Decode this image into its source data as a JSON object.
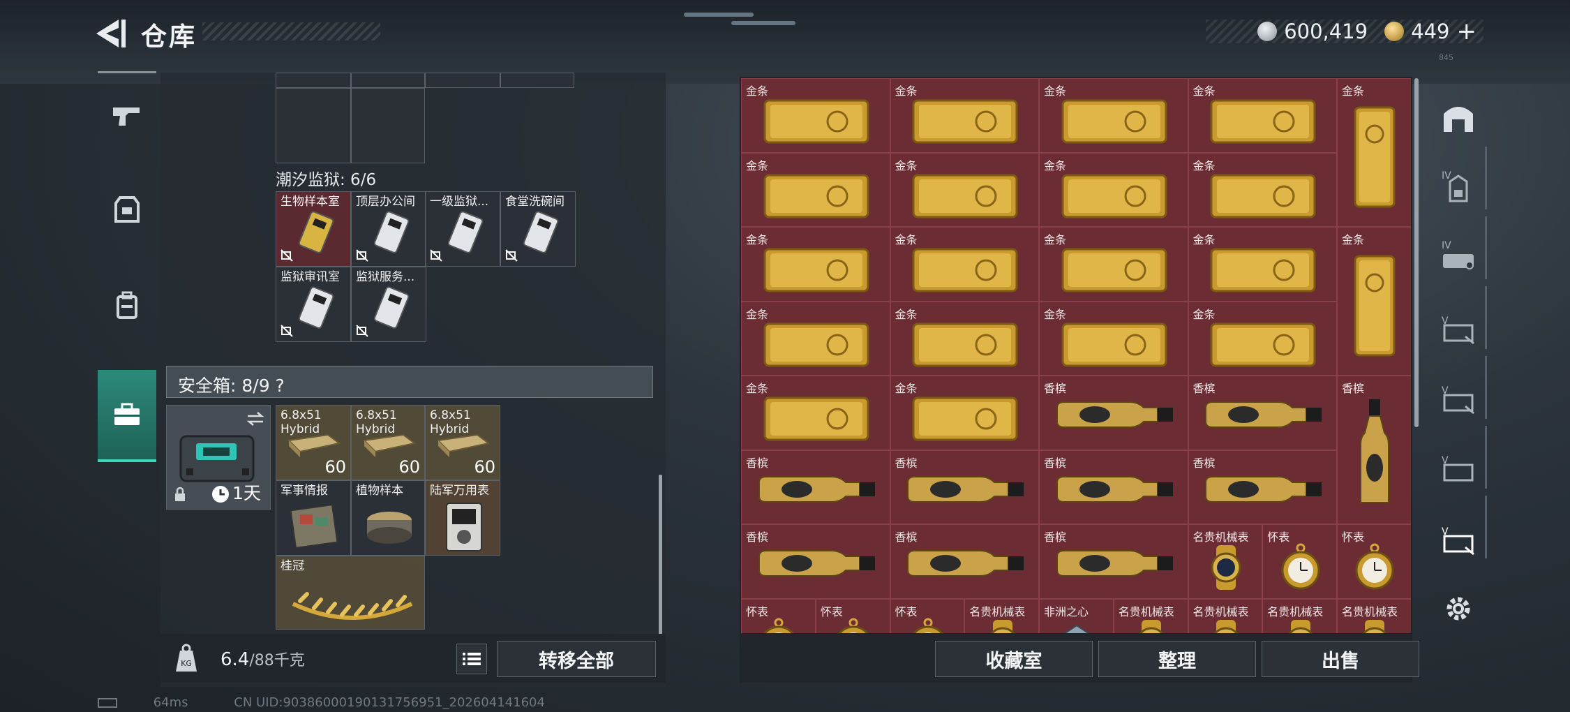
{
  "header": {
    "title": "仓库",
    "currency": [
      {
        "icon": "silver-coin-icon",
        "value": "600,419"
      },
      {
        "icon": "gold-coin-icon",
        "value": "449",
        "plus": "+"
      }
    ],
    "note": "845"
  },
  "left_nav": {
    "items": [
      {
        "name": "weapon-nav-icon"
      },
      {
        "name": "armor-nav-icon"
      },
      {
        "name": "backpack-nav-icon"
      },
      {
        "name": "briefcase-nav-icon",
        "active": true
      }
    ]
  },
  "keycards": {
    "section_label": "潮汐监狱: 6/6",
    "items": [
      {
        "label": "生物样本室",
        "color": "red"
      },
      {
        "label": "顶层办公间",
        "color": "dark"
      },
      {
        "label": "一级监狱...",
        "color": "dark"
      },
      {
        "label": "食堂洗碗间",
        "color": "dark"
      },
      {
        "label": "监狱审讯室",
        "color": "dark"
      },
      {
        "label": "监狱服务...",
        "color": "dark"
      }
    ]
  },
  "safebox": {
    "label": "安全箱: 8/9 ?",
    "timer": "1天",
    "items": [
      {
        "label": "6.8x51 Hybrid",
        "count": "60",
        "color": "gold"
      },
      {
        "label": "6.8x51 Hybrid",
        "count": "60",
        "color": "gold"
      },
      {
        "label": "6.8x51 Hybrid",
        "count": "60",
        "color": "gold"
      },
      {
        "label": "军事情报",
        "color": "dark"
      },
      {
        "label": "植物样本",
        "color": "dark"
      },
      {
        "label": "陆军万用表",
        "color": "brown"
      },
      {
        "label": "桂冠",
        "color": "gold"
      }
    ]
  },
  "weight": {
    "current": "6.4",
    "max": "/88千克"
  },
  "left_buttons": {
    "transfer_all": "转移全部"
  },
  "grid_items": [
    {
      "label": "金条",
      "kind": "bar"
    },
    {
      "label": "金条",
      "kind": "bar"
    },
    {
      "label": "金条",
      "kind": "bar"
    },
    {
      "label": "金条",
      "kind": "bar"
    },
    {
      "label": "金条",
      "kind": "vbar"
    },
    {
      "label": "金条",
      "kind": "bar"
    },
    {
      "label": "金条",
      "kind": "bar"
    },
    {
      "label": "金条",
      "kind": "bar"
    },
    {
      "label": "金条",
      "kind": "bar"
    },
    {
      "label": "金条",
      "kind": "bar"
    },
    {
      "label": "金条",
      "kind": "bar"
    },
    {
      "label": "金条",
      "kind": "bar"
    },
    {
      "label": "金条",
      "kind": "bar"
    },
    {
      "label": "金条",
      "kind": "vbar"
    },
    {
      "label": "金条",
      "kind": "bar"
    },
    {
      "label": "金条",
      "kind": "bar"
    },
    {
      "label": "金条",
      "kind": "bar"
    },
    {
      "label": "金条",
      "kind": "bar"
    },
    {
      "label": "金条",
      "kind": "bar"
    },
    {
      "label": "金条",
      "kind": "bar"
    },
    {
      "label": "香槟",
      "kind": "bottle"
    },
    {
      "label": "香槟",
      "kind": "bottle"
    },
    {
      "label": "香槟",
      "kind": "vbottle"
    },
    {
      "label": "香槟",
      "kind": "bottle"
    },
    {
      "label": "香槟",
      "kind": "bottle"
    },
    {
      "label": "香槟",
      "kind": "bottle"
    },
    {
      "label": "香槟",
      "kind": "bottle"
    },
    {
      "label": "香槟",
      "kind": "bottle"
    },
    {
      "label": "香槟",
      "kind": "bottle"
    },
    {
      "label": "香槟",
      "kind": "bottle"
    },
    {
      "label": "名贵机械表",
      "kind": "watch"
    },
    {
      "label": "怀表",
      "kind": "pocketwatch"
    },
    {
      "label": "怀表",
      "kind": "pocketwatch"
    },
    {
      "label": "怀表",
      "kind": "pocketwatch"
    },
    {
      "label": "怀表",
      "kind": "pocketwatch"
    },
    {
      "label": "怀表",
      "kind": "pocketwatch"
    },
    {
      "label": "名贵机械表",
      "kind": "watch"
    },
    {
      "label": "非洲之心",
      "kind": "gem"
    },
    {
      "label": "名贵机械表",
      "kind": "watch"
    },
    {
      "label": "名贵机械表",
      "kind": "watch"
    },
    {
      "label": "名贵机械表",
      "kind": "watch"
    },
    {
      "label": "名贵机械表",
      "kind": "watch"
    }
  ],
  "right_buttons": {
    "collection": "收藏室",
    "sort": "整理",
    "sell": "出售"
  },
  "right_rail": [
    {
      "name": "home-tab-icon"
    },
    {
      "name": "rig-iv-tab-icon"
    },
    {
      "name": "vehicle-iv-tab-icon"
    },
    {
      "name": "storage-v1-tab-icon"
    },
    {
      "name": "storage-v2-tab-icon"
    },
    {
      "name": "storage-v3-tab-icon"
    },
    {
      "name": "storage-v4-tab-icon"
    },
    {
      "name": "settings-icon"
    }
  ],
  "status": {
    "ping": "64ms",
    "uid": "CN UID:90386000190131756951_202604141604"
  },
  "colors": {
    "accent": "#3fd3b8",
    "grid_cell": "#6b2d33",
    "gold": "#d4a83a"
  }
}
